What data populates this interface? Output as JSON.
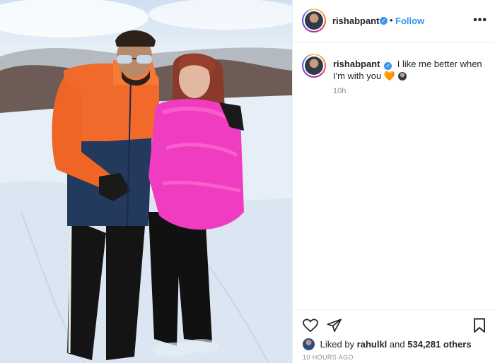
{
  "post": {
    "username": "rishabpant",
    "verified_mark": "✓",
    "separator": "•",
    "follow_label": "Follow",
    "more_label": "•••",
    "caption": "I like me better when I'm with you",
    "caption_emojis": "🧡",
    "comment_age": "10h",
    "likes_prefix": "Liked by",
    "liked_by_user": "rahulkl",
    "likes_and": "and",
    "likes_count": "534,281 others",
    "timestamp": "10 HOURS AGO"
  },
  "icons": {
    "like": "heart-outline-icon",
    "share": "paper-plane-icon",
    "save": "bookmark-icon",
    "more": "more-options-icon",
    "verified": "verified-badge-icon"
  },
  "colors": {
    "link_blue": "#3897f0",
    "muted": "#8e8e8e",
    "text": "#262626",
    "orange_jacket": "#f26a2b",
    "pink_jacket": "#f03cc0"
  }
}
